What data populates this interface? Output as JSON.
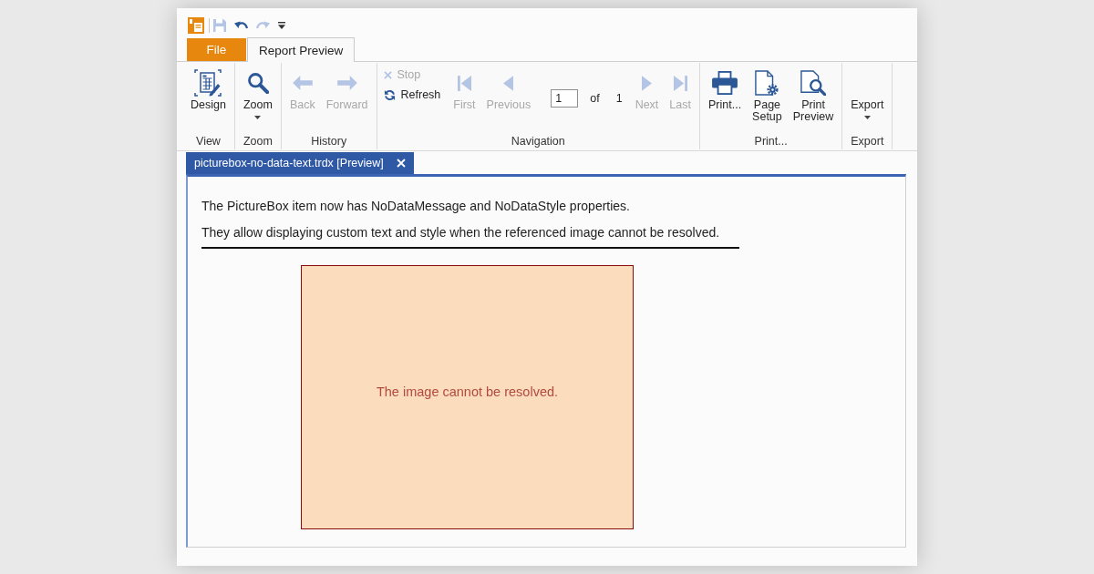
{
  "quick_access": [
    {
      "kind": "save",
      "disabled": true
    },
    {
      "kind": "undo",
      "disabled": false
    },
    {
      "kind": "redo",
      "disabled": true
    },
    {
      "kind": "customize",
      "disabled": false
    }
  ],
  "ribbon": {
    "file_button": "File",
    "tabs": [
      {
        "label": "Report Preview",
        "selected": true
      }
    ],
    "groups": [
      {
        "label": "View",
        "items": [
          {
            "kind": "design",
            "label": "Design",
            "disabled": false,
            "dropdown": false
          }
        ]
      },
      {
        "label": "Zoom",
        "items": [
          {
            "kind": "zoom",
            "label": "Zoom",
            "disabled": false,
            "dropdown": true
          }
        ]
      },
      {
        "label": "History",
        "items": [
          {
            "kind": "back",
            "label": "Back",
            "disabled": true,
            "dropdown": false
          },
          {
            "kind": "forward",
            "label": "Forward",
            "disabled": true,
            "dropdown": false
          }
        ]
      },
      {
        "label": "Navigation",
        "items": [
          {
            "kind": "stop",
            "label": "Stop",
            "disabled": true,
            "dropdown": false
          },
          {
            "kind": "refresh",
            "label": "Refresh",
            "disabled": false,
            "dropdown": false
          },
          {
            "kind": "first",
            "label": "First",
            "disabled": true,
            "dropdown": false
          },
          {
            "kind": "previous",
            "label": "Previous",
            "disabled": true,
            "dropdown": false
          },
          {
            "kind": "pager",
            "page": "1",
            "of_label": "of",
            "page_count": "1"
          },
          {
            "kind": "next",
            "label": "Next",
            "disabled": true,
            "dropdown": false
          },
          {
            "kind": "last",
            "label": "Last",
            "disabled": true,
            "dropdown": false
          }
        ]
      },
      {
        "label": "Print...",
        "items": [
          {
            "kind": "print",
            "label": "Print...",
            "disabled": false,
            "dropdown": false
          },
          {
            "kind": "pagesetup",
            "label": "Page Setup",
            "disabled": false,
            "dropdown": false
          },
          {
            "kind": "preview",
            "label": "Print Preview",
            "disabled": false,
            "dropdown": false
          }
        ]
      },
      {
        "label": "Export",
        "items": [
          {
            "kind": "export",
            "label": "Export",
            "disabled": false,
            "dropdown": true
          }
        ]
      }
    ]
  },
  "document_tabs": [
    {
      "title": "picturebox-no-data-text.trdx [Preview]",
      "selected": true
    }
  ],
  "report": {
    "lines": [
      "The PictureBox item now has NoDataMessage and NoDataStyle properties.",
      "They allow displaying custom text and style when the referenced image cannot be resolved."
    ],
    "picture_box": {
      "message": "The image cannot be resolved."
    }
  }
}
